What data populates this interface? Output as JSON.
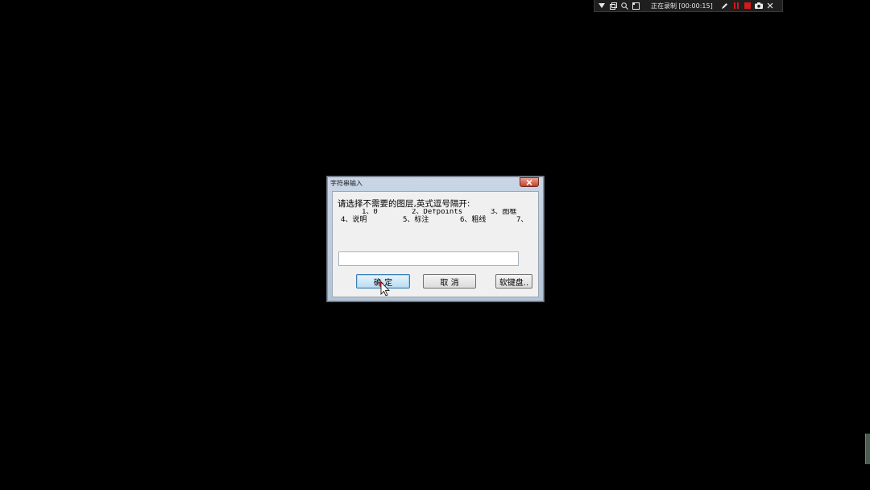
{
  "recorder": {
    "status": "正在录制 [00:00:15]",
    "icons": [
      "dropdown-icon",
      "restore-icon",
      "zoom-icon",
      "region-icon",
      "pen-icon",
      "pause-icon",
      "stop-icon",
      "camera-icon",
      "close-icon"
    ],
    "stop_color": "#d11a1a"
  },
  "dialog": {
    "title": "字符串输入",
    "prompt": "请选择不需要的图层,英式逗号隔开:",
    "layers": [
      [
        {
          "text": "1、0"
        },
        {
          "text": "2、Defpoints"
        },
        {
          "text": "3、图框"
        }
      ],
      [
        {
          "text": "4、说明"
        },
        {
          "text": "5、标注"
        },
        {
          "text": "6、粗线"
        },
        {
          "text": "7、"
        }
      ]
    ],
    "input": {
      "value": "",
      "placeholder": ""
    },
    "buttons": {
      "ok": "确 定",
      "cancel": "取 消",
      "keyboard": "软键盘.."
    }
  },
  "colors": {
    "background": "#000000",
    "dialog_frame": "#b4c4d8",
    "ok_button": "#b9dcf3",
    "close_button": "#c6402a"
  }
}
